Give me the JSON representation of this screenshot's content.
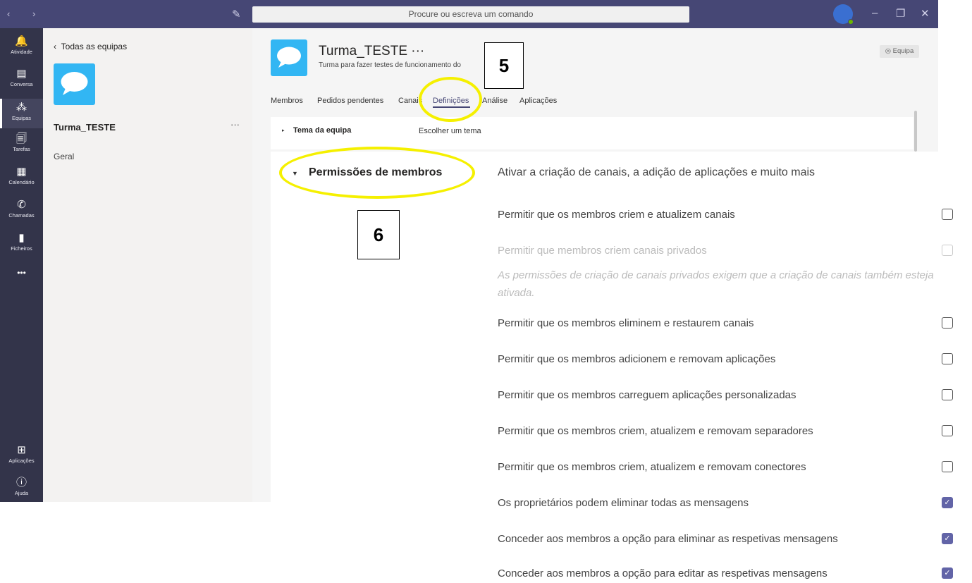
{
  "titlebar": {
    "nav_arrows": "‹ ›",
    "search_placeholder": "Procure ou escreva um comando",
    "window_controls": [
      "–",
      "❐",
      "✕"
    ]
  },
  "rail": {
    "items": [
      {
        "label": "Atividade",
        "icon": "bell-icon",
        "glyph": "🔔"
      },
      {
        "label": "Conversa",
        "icon": "chat-icon",
        "glyph": "▤"
      },
      {
        "label": "Equipas",
        "icon": "teams-icon",
        "glyph": "⁂"
      },
      {
        "label": "Tarefas",
        "icon": "tasks-icon",
        "glyph": "🗐"
      },
      {
        "label": "Calendário",
        "icon": "calendar-icon",
        "glyph": "▦"
      },
      {
        "label": "Chamadas",
        "icon": "phone-icon",
        "glyph": "✆"
      },
      {
        "label": "Ficheiros",
        "icon": "file-icon",
        "glyph": "▮"
      }
    ],
    "more": "•••",
    "apps_label": "Aplicações",
    "help_label": "Ajuda"
  },
  "teampanel": {
    "back_label": "Todas as equipas",
    "team_name": "Turma_TESTE",
    "team_more": "···",
    "channel": "Geral"
  },
  "header": {
    "title": "Turma_TESTE ···",
    "subtitle": "Turma para fazer testes de funcionamento do",
    "equipa_button": "◎ Equipa",
    "tabs": [
      "Membros",
      "Pedidos pendentes",
      "Canais",
      "Definições",
      "Análise",
      "Aplicações"
    ],
    "active_tab": "Definições"
  },
  "settings": {
    "theme_label": "Tema da equipa",
    "theme_value": "Escolher um tema",
    "perm_title": "Permissões de membros",
    "perm_desc": "Ativar a criação de canais, a adição de aplicações e muito mais",
    "options": [
      {
        "label": "Permitir que os membros criem e atualizem canais",
        "checked": false,
        "disabled": false
      },
      {
        "label": "Permitir que membros criem canais privados",
        "checked": false,
        "disabled": true
      },
      {
        "label": "Permitir que os membros eliminem e restaurem canais",
        "checked": false,
        "disabled": false
      },
      {
        "label": "Permitir que os membros adicionem e removam aplicações",
        "checked": false,
        "disabled": false
      },
      {
        "label": "Permitir que os membros carreguem aplicações personalizadas",
        "checked": false,
        "disabled": false
      },
      {
        "label": "Permitir que os membros criem, atualizem e removam separadores",
        "checked": false,
        "disabled": false
      },
      {
        "label": "Permitir que os membros criem, atualizem e removam conectores",
        "checked": false,
        "disabled": false
      },
      {
        "label": "Os proprietários podem eliminar todas as mensagens",
        "checked": true,
        "disabled": false
      },
      {
        "label": "Conceder aos membros a opção para eliminar as respetivas mensagens",
        "checked": true,
        "disabled": false
      },
      {
        "label": "Conceder aos membros a opção para editar as respetivas mensagens",
        "checked": true,
        "disabled": false
      }
    ],
    "private_note": "As permissões de criação de canais privados exigem que a criação de canais também esteja ativada."
  },
  "annotations": {
    "step5": "5",
    "step6": "6"
  },
  "colors": {
    "titlebar": "#464775",
    "rail": "#33344a",
    "accent": "#6264a7",
    "highlight": "#f5f000"
  }
}
